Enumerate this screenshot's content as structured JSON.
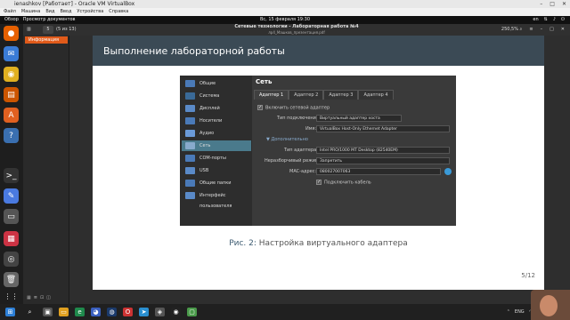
{
  "window": {
    "title": "ienashkov [Работает] - Oracle VM VirtualBox"
  },
  "vbox_menu": [
    "Файл",
    "Машина",
    "Вид",
    "Ввод",
    "Устройства",
    "Справка"
  ],
  "topbar": {
    "activities": "Обзор",
    "app": "Просмотр документов",
    "clock": "Вс, 15 февраля 19:30",
    "lang": "en"
  },
  "viewer": {
    "page_input": "5",
    "page_total": "(5 из 13)",
    "doc_title": "Сетевые технологии - Лабораторная работа №4",
    "doc_file": "лр4_Машков_презентация.pdf",
    "zoom": "250,5%"
  },
  "sidebar": {
    "tab": "Информация"
  },
  "slide": {
    "header": "Выполнение лабораторной работы",
    "caption_prefix": "Рис. 2:",
    "caption_text": " Настройка виртуального адаптера",
    "page_num": "5/12"
  },
  "dialog": {
    "side_items": [
      "Общие",
      "Система",
      "Дисплей",
      "Носители",
      "Аудио",
      "Сеть",
      "COM-порты",
      "USB",
      "Общие папки",
      "Интерфейс пользователя"
    ],
    "selected": "Сеть",
    "title": "Сеть",
    "tabs": [
      "Адаптер 1",
      "Адаптер 2",
      "Адаптер 3",
      "Адаптер 4"
    ],
    "enable": "Включить сетевой адаптер",
    "attach_label": "Тип подключения:",
    "attach_value": "Виртуальный адаптер хоста",
    "name_label": "Имя:",
    "name_value": "VirtualBox Host-Only Ethernet Adapter",
    "advanced": "Дополнительно",
    "type_label": "Тип адаптера:",
    "type_value": "Intel PRO/1000 MT Desktop (82540EM)",
    "promisc_label": "Неразборчивый режим:",
    "promisc_value": "Запретить",
    "mac_label": "MAC-адрес:",
    "mac_value": "080027007063",
    "cable": "Подключить кабель"
  },
  "taskbar": {
    "lang": "ENG",
    "time": "19:30",
    "date": "15.02.2026"
  }
}
